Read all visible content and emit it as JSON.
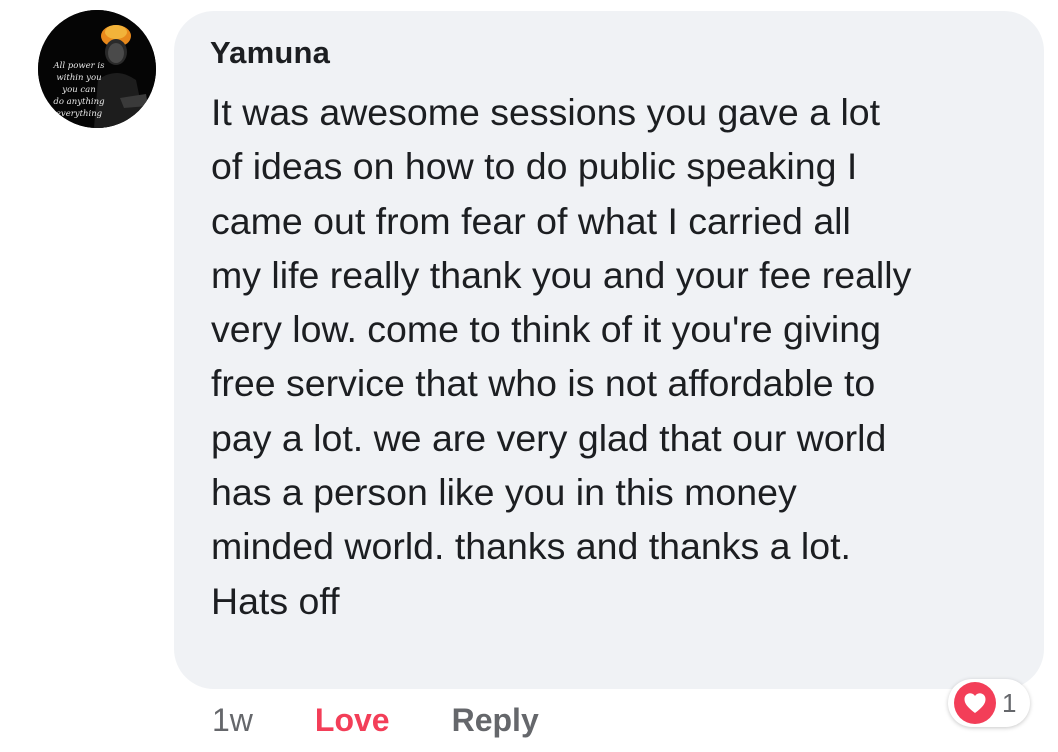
{
  "comment": {
    "avatar": {
      "caption": "All power is\nwithin you\nyou can\ndo anything\neverything"
    },
    "author": "Yamuna",
    "text": "It was awesome sessions you gave a lot\nof ideas on how to do public speaking I\ncame out from fear of what I carried all\nmy life really thank you and your fee really\nvery low. come to think of it you're giving\nfree service that who is not affordable to\npay a lot. we are very glad that our world\nhas a person like you in this money\nminded world. thanks and thanks a lot.\nHats off",
    "timestamp": "1w",
    "reaction_label": "Love",
    "reply_label": "Reply",
    "reactions": {
      "icon": "heart-icon",
      "count": "1"
    }
  },
  "colors": {
    "bubble_bg": "#f0f2f5",
    "love_red": "#f33e58",
    "secondary_text": "#65676b",
    "primary_text": "#1c1e21"
  }
}
